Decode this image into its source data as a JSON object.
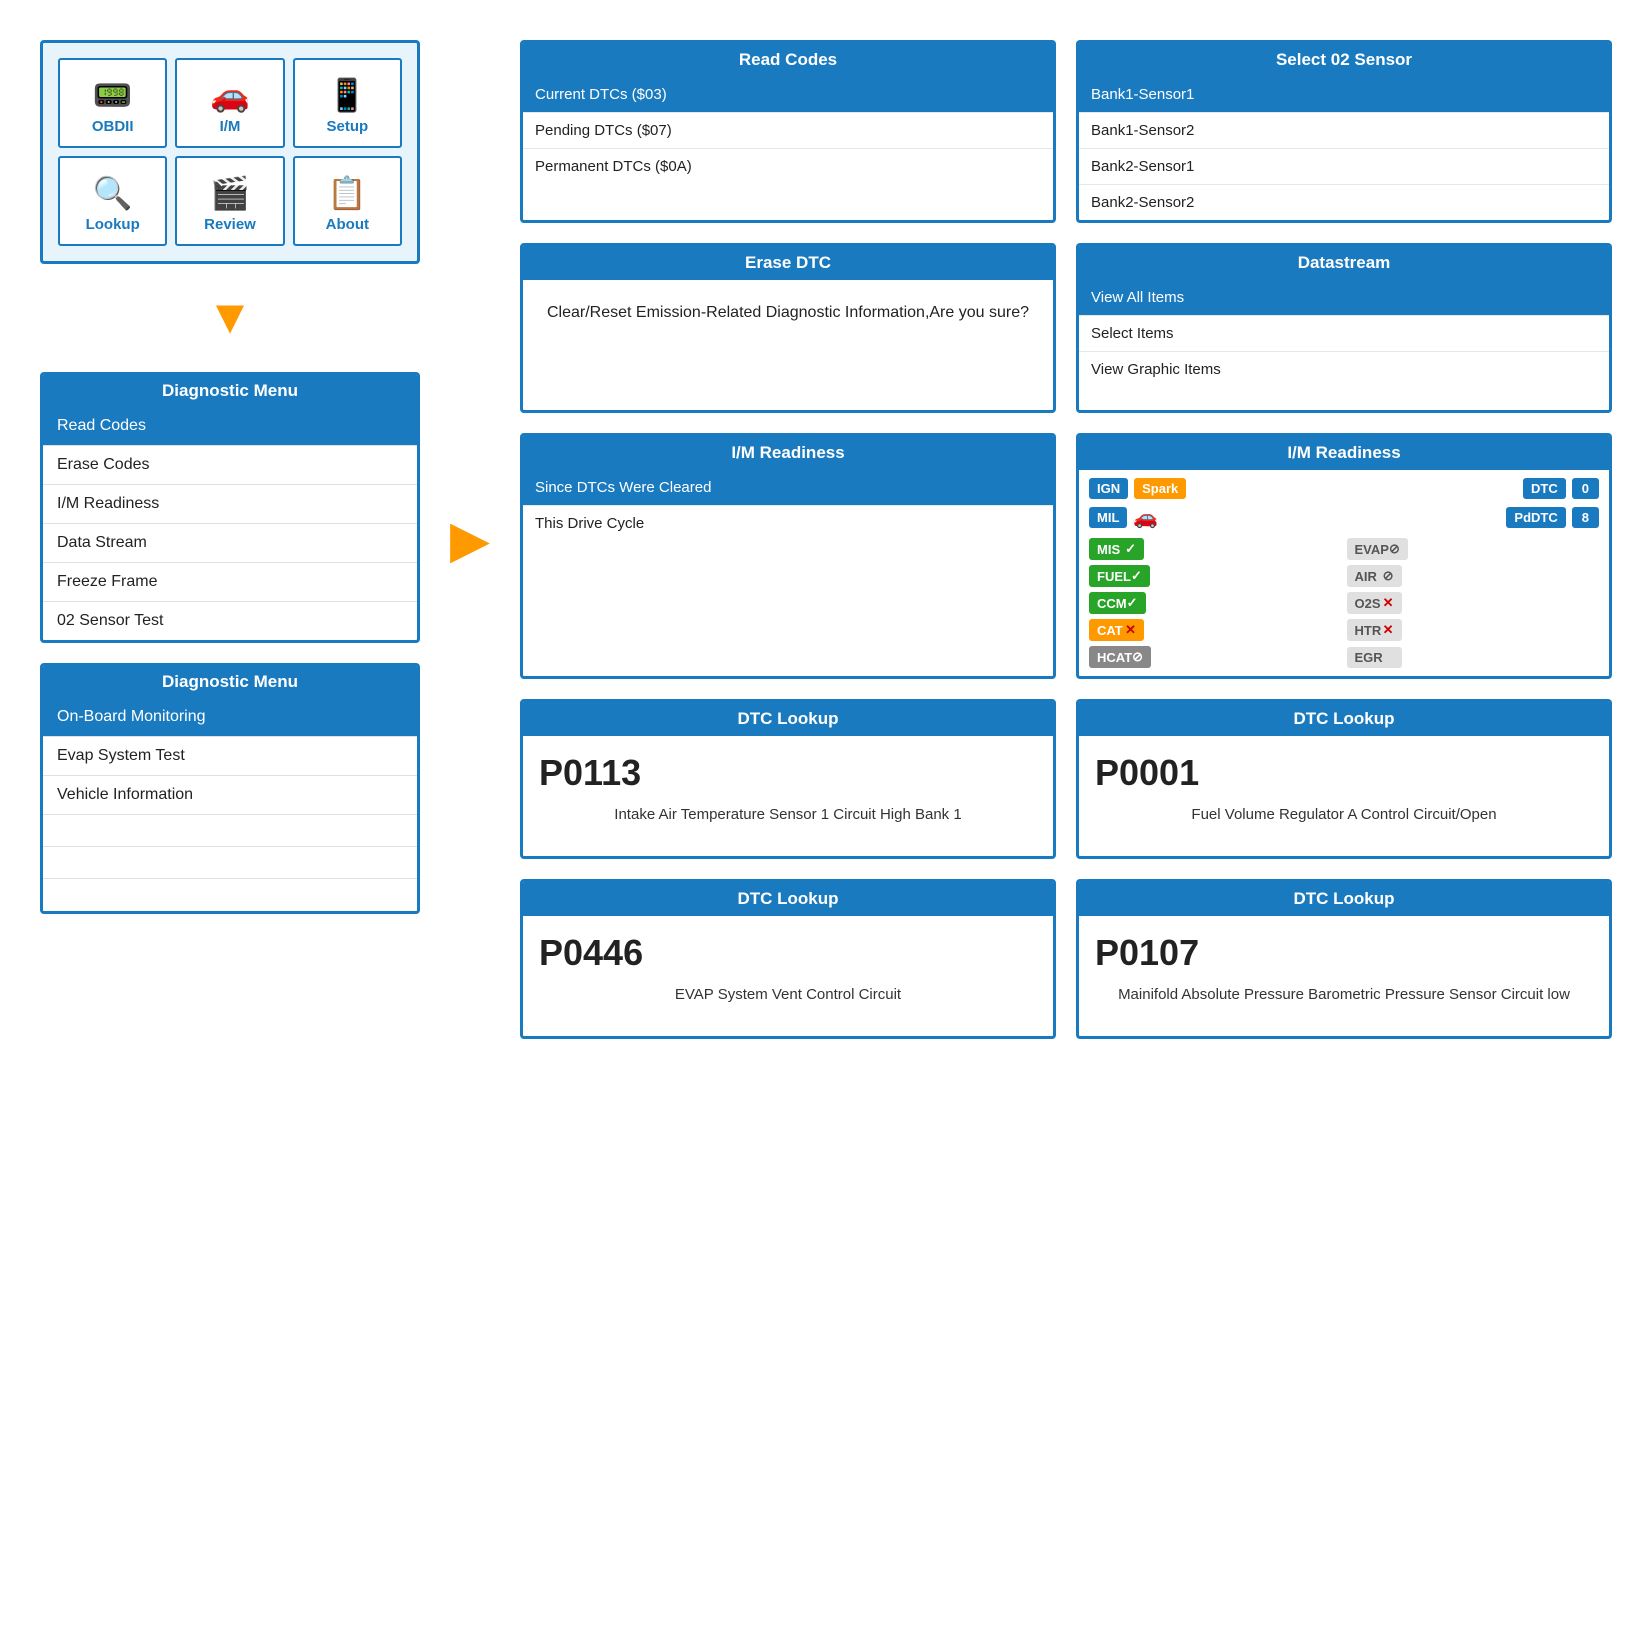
{
  "deviceMenu": {
    "items": [
      {
        "label": "OBDII",
        "icon": "📟"
      },
      {
        "label": "I/M",
        "icon": "🚗"
      },
      {
        "label": "Setup",
        "icon": "📱"
      },
      {
        "label": "Lookup",
        "icon": "🔍"
      },
      {
        "label": "Review",
        "icon": "🎬"
      },
      {
        "label": "About",
        "icon": "📋"
      }
    ]
  },
  "diagnosticMenu1": {
    "header": "Diagnostic Menu",
    "items": [
      {
        "label": "Read Codes",
        "selected": true
      },
      {
        "label": "Erase Codes",
        "selected": false
      },
      {
        "label": "I/M Readiness",
        "selected": false
      },
      {
        "label": "Data Stream",
        "selected": false
      },
      {
        "label": "Freeze Frame",
        "selected": false
      },
      {
        "label": "02 Sensor Test",
        "selected": false
      }
    ]
  },
  "diagnosticMenu2": {
    "header": "Diagnostic Menu",
    "items": [
      {
        "label": "On-Board Monitoring",
        "selected": true
      },
      {
        "label": "Evap System Test",
        "selected": false
      },
      {
        "label": "Vehicle Information",
        "selected": false
      },
      {
        "label": "",
        "empty": true
      },
      {
        "label": "",
        "empty": true
      },
      {
        "label": "",
        "empty": true
      }
    ]
  },
  "readCodes": {
    "header": "Read Codes",
    "items": [
      {
        "label": "Current DTCs ($03)",
        "selected": true
      },
      {
        "label": "Pending DTCs ($07)",
        "selected": false
      },
      {
        "label": "Permanent DTCs ($0A)",
        "selected": false
      }
    ]
  },
  "select02Sensor": {
    "header": "Select 02 Sensor",
    "items": [
      {
        "label": "Bank1-Sensor1",
        "selected": true
      },
      {
        "label": "Bank1-Sensor2",
        "selected": false
      },
      {
        "label": "Bank2-Sensor1",
        "selected": false
      },
      {
        "label": "Bank2-Sensor2",
        "selected": false
      }
    ]
  },
  "eraseDTC": {
    "header": "Erase DTC",
    "message": "Clear/Reset Emission-Related Diagnostic Information,Are you sure?"
  },
  "datastream": {
    "header": "Datastream",
    "items": [
      {
        "label": "View All Items",
        "selected": true
      },
      {
        "label": "Select Items",
        "selected": false
      },
      {
        "label": "View Graphic Items",
        "selected": false
      }
    ]
  },
  "imReadinessLeft": {
    "header": "I/M Readiness",
    "items": [
      {
        "label": "Since DTCs Were Cleared",
        "selected": true
      },
      {
        "label": "This Drive Cycle",
        "selected": false
      }
    ]
  },
  "imReadinessRight": {
    "header": "I/M Readiness",
    "topLeft1": "IGN",
    "topLeft2": "Spark",
    "topRight1": "DTC",
    "topRight2": "0",
    "midLeft": "MIL",
    "midRight1": "PdDTC",
    "midRight2": "8",
    "statuses": [
      {
        "label": "MIS",
        "check": "✓",
        "color": "green",
        "right_label": "EVAP",
        "right_symbol": "⊘",
        "right_color": "gray"
      },
      {
        "label": "FUEL",
        "check": "✓",
        "color": "green",
        "right_label": "AIR",
        "right_symbol": "⊘",
        "right_color": "gray"
      },
      {
        "label": "CCM",
        "check": "✓",
        "color": "green",
        "right_label": "O2S",
        "right_symbol": "✕",
        "right_color": "red"
      },
      {
        "label": "CAT",
        "check": "✕",
        "color": "orange",
        "right_label": "HTR",
        "right_symbol": "✕",
        "right_color": "red"
      },
      {
        "label": "HCAT",
        "check": "⊘",
        "color": "gray",
        "right_label": "EGR",
        "right_symbol": "",
        "right_color": "gray"
      }
    ]
  },
  "dtcLookup1": {
    "header": "DTC Lookup",
    "code": "P0113",
    "description": "Intake Air Temperature Sensor 1 Circuit High Bank 1"
  },
  "dtcLookup2": {
    "header": "DTC Lookup",
    "code": "P0001",
    "description": "Fuel Volume Regulator A Control Circuit/Open"
  },
  "dtcLookup3": {
    "header": "DTC Lookup",
    "code": "P0446",
    "description": "EVAP System Vent Control Circuit"
  },
  "dtcLookup4": {
    "header": "DTC Lookup",
    "code": "P0107",
    "description": "Mainifold Absolute Pressure Barometric Pressure Sensor Circuit low"
  }
}
